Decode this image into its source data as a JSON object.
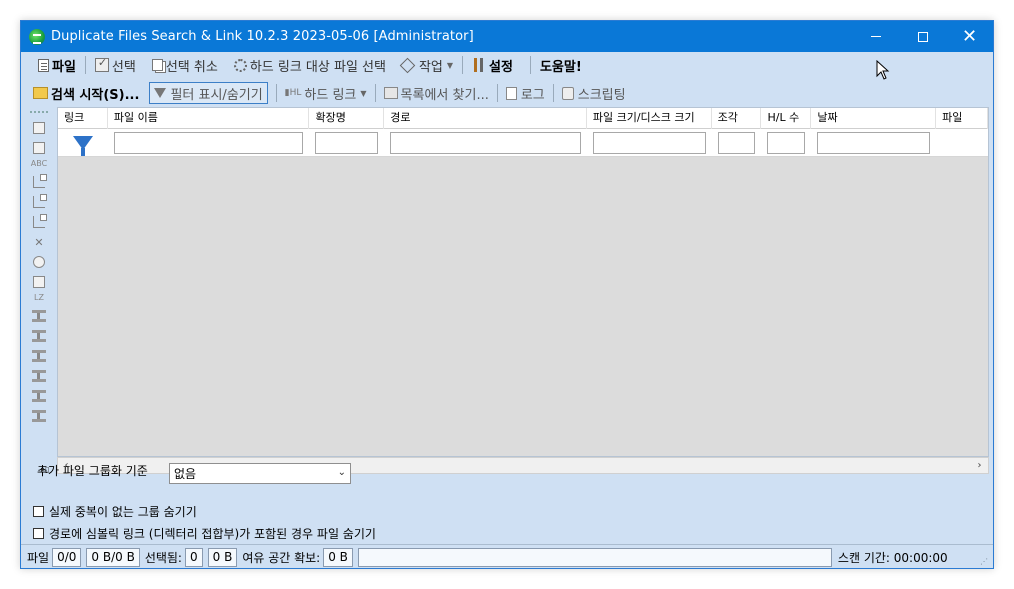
{
  "window": {
    "title": "Duplicate Files Search & Link 10.2.3 2023-05-06 [Administrator]"
  },
  "menu": {
    "file": "파일",
    "select": "선택",
    "deselect": "선택 취소",
    "select_hardlink_targets": "하드 링크 대상 파일 선택",
    "actions": "작업",
    "settings": "설정",
    "help": "도움말!"
  },
  "toolbar": {
    "start_search": "검색 시작(S)...",
    "toggle_filter": "필터 표시/숨기기",
    "hard_link": "하드 링크",
    "find_in_list": "목록에서 찾기...",
    "log": "로그",
    "scripting": "스크립팅"
  },
  "left_toolbar": {
    "abc_label": "ABC",
    "lz_label": "LZ"
  },
  "grid": {
    "columns": [
      {
        "label": "링크"
      },
      {
        "label": "파일 이름"
      },
      {
        "label": "확장명"
      },
      {
        "label": "경로"
      },
      {
        "label": "파일 크기/디스크 크기"
      },
      {
        "label": "조각"
      },
      {
        "label": "H/L 수"
      },
      {
        "label": "날짜"
      },
      {
        "label": "파일"
      }
    ]
  },
  "grouping": {
    "label": "추가 파일 그룹화 기준",
    "selected": "없음"
  },
  "options": {
    "hide_non_duplicate_groups": "실제 중복이 없는 그룹 숨기기",
    "hide_symlink_paths": "경로에 심볼릭 링크 (디렉터리 접합부)가 포함된 경우 파일 숨기기"
  },
  "status": {
    "files_label": "파일",
    "files_count": "0/0",
    "files_size": "0 B/0 B",
    "selected_label": "선택됨:",
    "selected_count": "0",
    "selected_size": "0 B",
    "freed_label": "여유 공간 확보:",
    "freed_value": "0 B",
    "scan_time": "스캔 기간: 00:00:00"
  }
}
